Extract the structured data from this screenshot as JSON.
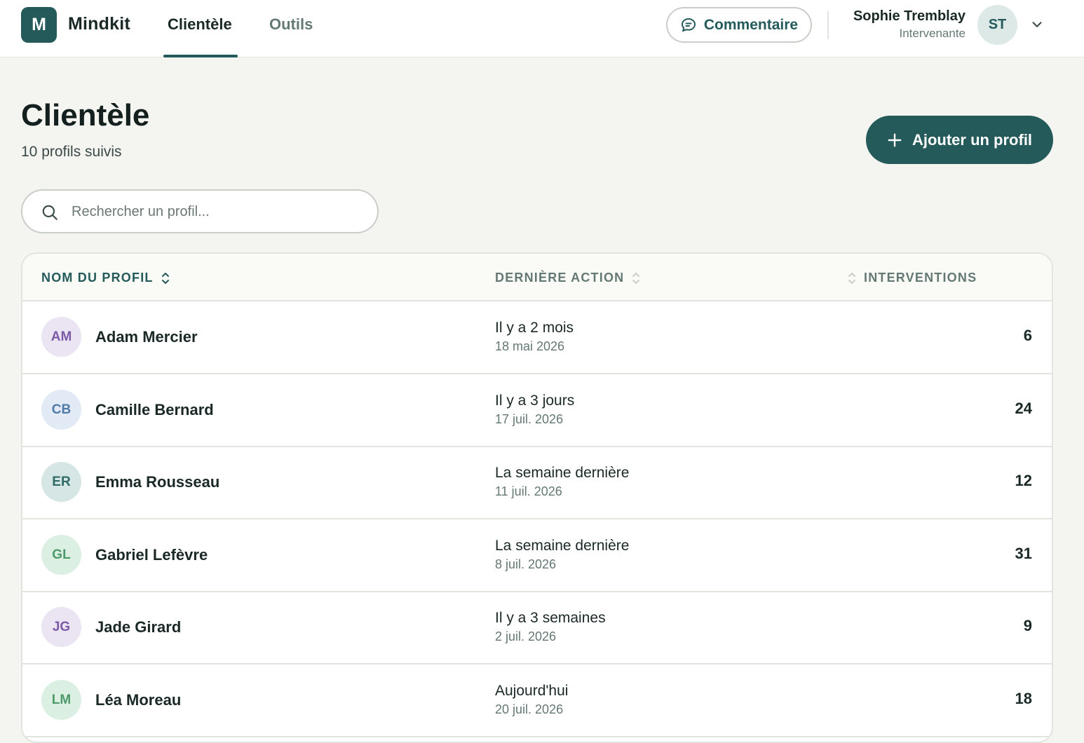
{
  "app": {
    "logo_letter": "M",
    "name": "Mindkit"
  },
  "nav": {
    "tabs": [
      {
        "label": "Clientèle",
        "active": true
      },
      {
        "label": "Outils",
        "active": false
      }
    ]
  },
  "header": {
    "comment_label": "Commentaire",
    "user": {
      "name": "Sophie Tremblay",
      "role": "Intervenante",
      "initials": "ST"
    }
  },
  "page": {
    "title": "Clientèle",
    "subtitle": "10 profils suivis",
    "add_button_label": "Ajouter un profil"
  },
  "search": {
    "placeholder": "Rechercher un profil...",
    "value": ""
  },
  "table": {
    "columns": [
      "NOM DU PROFIL",
      "DERNIÈRE ACTION",
      "INTERVENTIONS"
    ],
    "rows": [
      {
        "initials": "AM",
        "name": "Adam Mercier",
        "relative": "Il y a 2 mois",
        "date": "18 mai 2026",
        "count": "6",
        "avatar_bg": "#ebe4f3",
        "avatar_fg": "#7b5aa6"
      },
      {
        "initials": "CB",
        "name": "Camille Bernard",
        "relative": "Il y a 3 jours",
        "date": "17 juil. 2026",
        "count": "24",
        "avatar_bg": "#e2ebf5",
        "avatar_fg": "#4f7aa8"
      },
      {
        "initials": "ER",
        "name": "Emma Rousseau",
        "relative": "La semaine dernière",
        "date": "11 juil. 2026",
        "count": "12",
        "avatar_bg": "#d6e6e4",
        "avatar_fg": "#2e6a66"
      },
      {
        "initials": "GL",
        "name": "Gabriel Lefèvre",
        "relative": "La semaine dernière",
        "date": "8 juil. 2026",
        "count": "31",
        "avatar_bg": "#dcefe3",
        "avatar_fg": "#4c9a6a"
      },
      {
        "initials": "JG",
        "name": "Jade Girard",
        "relative": "Il y a 3 semaines",
        "date": "2 juil. 2026",
        "count": "9",
        "avatar_bg": "#ebe4f3",
        "avatar_fg": "#7b5aa6"
      },
      {
        "initials": "LM",
        "name": "Léa Moreau",
        "relative": "Aujourd'hui",
        "date": "20 juil. 2026",
        "count": "18",
        "avatar_bg": "#dcefe3",
        "avatar_fg": "#4c9a6a"
      }
    ]
  },
  "colors": {
    "accent": "#245a5a",
    "background": "#f4f4f1",
    "muted_text": "#647874"
  }
}
